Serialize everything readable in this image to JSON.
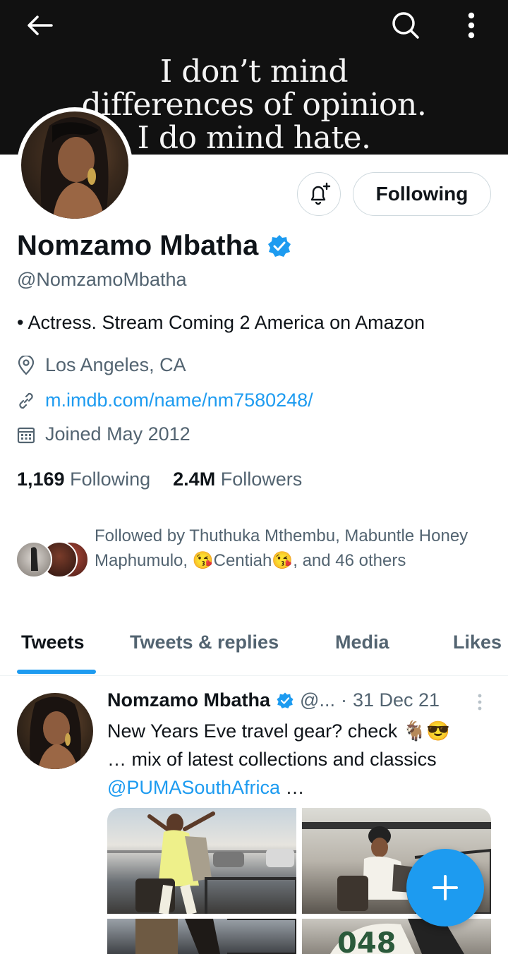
{
  "banner": {
    "quote_line1": "I don’t mind",
    "quote_line2": "differences of opinion.",
    "quote_line3": "I do mind hate."
  },
  "header": {
    "back_icon": "arrow-left-icon",
    "search_icon": "search-icon",
    "more_icon": "more-vertical-icon"
  },
  "profile": {
    "name": "Nomzamo Mbatha",
    "handle": "@NomzamoMbatha",
    "bio": "• Actress. Stream Coming 2 America on Amazon",
    "location": "Los Angeles, CA",
    "website": "m.imdb.com/name/nm7580248/",
    "joined": "Joined May 2012",
    "following_count": "1,169",
    "following_label": "Following",
    "followers_count": "2.4M",
    "followers_label": "Followers",
    "follow_button_label": "Following",
    "followed_by": "Followed by Thuthuka Mthembu, Mabuntle Honey Maphumulo, 😘Centiah😘, and 46 others"
  },
  "tabs": [
    {
      "label": "Tweets",
      "active": true
    },
    {
      "label": "Tweets & replies",
      "active": false
    },
    {
      "label": "Media",
      "active": false
    },
    {
      "label": "Likes",
      "active": false
    }
  ],
  "tweet": {
    "author": "Nomzamo Mbatha",
    "handle": "@...",
    "separator": "·",
    "date": "31 Dec 21",
    "text_line1": "New Years Eve travel gear? check 🐐😎",
    "text_line2": "… mix of latest collections and classics",
    "mention": "@PUMASouthAfrica",
    "ellipsis": " …"
  },
  "colors": {
    "accent": "#1d9bf0",
    "text": "#0f1419",
    "muted": "#536471",
    "border": "#cfd9de"
  }
}
